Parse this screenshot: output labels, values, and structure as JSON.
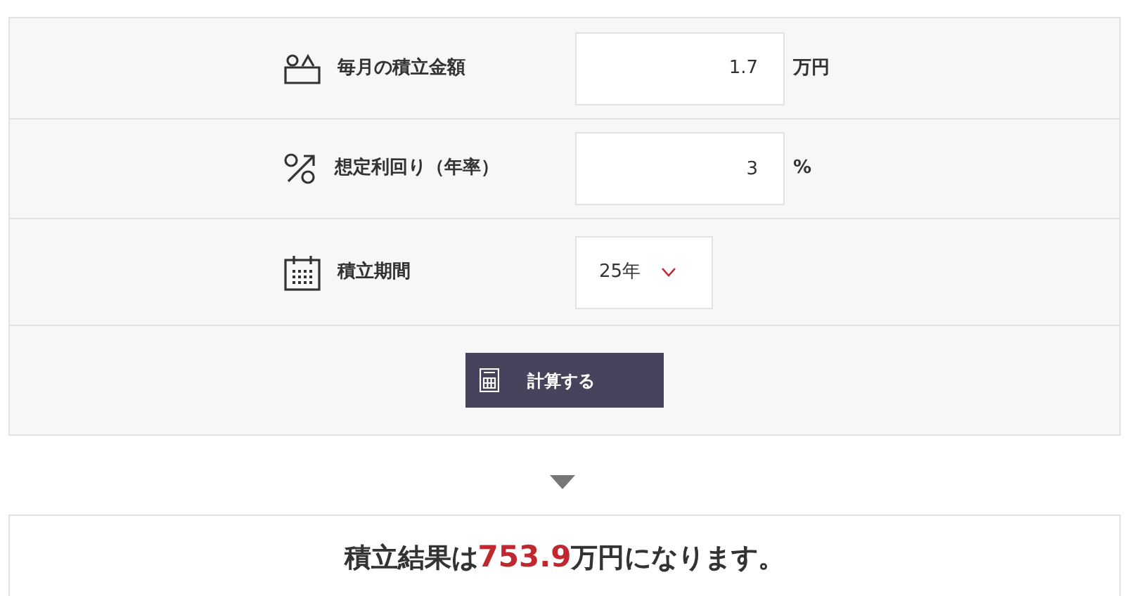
{
  "fields": [
    {
      "kind": "input",
      "label": "毎月の積立金額",
      "value": "1.7",
      "unit": "万円"
    },
    {
      "kind": "input",
      "label": "想定利回り（年率）",
      "value": "3",
      "unit": "%"
    },
    {
      "kind": "select",
      "label": "積立期間",
      "value": "25年"
    }
  ],
  "button": {
    "label": "計算する"
  },
  "result": {
    "prefix": "積立結果は",
    "value": "753.9",
    "suffix": "万円になります。"
  }
}
